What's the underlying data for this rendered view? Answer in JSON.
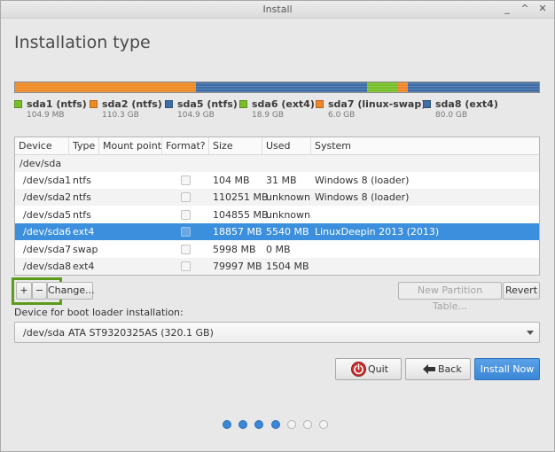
{
  "window": {
    "title": "Install"
  },
  "page": {
    "title": "Installation type"
  },
  "colors": {
    "ntfs_orange": "#ef8b27",
    "blue": "#3f6ea7",
    "green": "#78c02a",
    "swap_orange": "#f0862a",
    "selection": "#3c8fdc"
  },
  "partition_bar": [
    {
      "color": "#3f6ea7",
      "share": 0.0008
    },
    {
      "color": "#ef8b27",
      "share": 0.345
    },
    {
      "color": "#3f6ea7",
      "share": 0.327
    },
    {
      "color": "#78c02a",
      "share": 0.059
    },
    {
      "color": "#f0862a",
      "share": 0.019
    },
    {
      "color": "#3f6ea7",
      "share": 0.25
    }
  ],
  "legend": [
    {
      "name": "sda1 (ntfs)",
      "size": "104.9 MB",
      "color": "#78c02a"
    },
    {
      "name": "sda2 (ntfs)",
      "size": "110.3 GB",
      "color": "#ef8b27"
    },
    {
      "name": "sda5 (ntfs)",
      "size": "104.9 GB",
      "color": "#3f6ea7"
    },
    {
      "name": "sda6 (ext4)",
      "size": "18.9 GB",
      "color": "#78c02a"
    },
    {
      "name": "sda7 (linux-swap)",
      "size": "6.0 GB",
      "color": "#f0862a"
    },
    {
      "name": "sda8 (ext4)",
      "size": "80.0 GB",
      "color": "#3f6ea7"
    }
  ],
  "table": {
    "headers": [
      "Device",
      "Type",
      "Mount point",
      "Format?",
      "Size",
      "Used",
      "System"
    ],
    "group": "/dev/sda",
    "rows": [
      {
        "device": "/dev/sda1",
        "type": "ntfs",
        "mount": "",
        "size": "104 MB",
        "used": "31 MB",
        "system": "Windows 8 (loader)"
      },
      {
        "device": "/dev/sda2",
        "type": "ntfs",
        "mount": "",
        "size": "110251 MB",
        "used": "unknown",
        "system": "Windows 8 (loader)"
      },
      {
        "device": "/dev/sda5",
        "type": "ntfs",
        "mount": "",
        "size": "104855 MB",
        "used": "unknown",
        "system": ""
      },
      {
        "device": "/dev/sda6",
        "type": "ext4",
        "mount": "",
        "size": "18857 MB",
        "used": "5540 MB",
        "system": "LinuxDeepin 2013 (2013)"
      },
      {
        "device": "/dev/sda7",
        "type": "swap",
        "mount": "",
        "size": "5998 MB",
        "used": "0 MB",
        "system": ""
      },
      {
        "device": "/dev/sda8",
        "type": "ext4",
        "mount": "",
        "size": "79997 MB",
        "used": "1504 MB",
        "system": ""
      }
    ],
    "selected_index": 3
  },
  "toolbar": {
    "add": "+",
    "remove": "−",
    "change": "Change...",
    "new_table": "New Partition Table...",
    "revert": "Revert"
  },
  "boot": {
    "label": "Device for boot loader installation:",
    "device": "/dev/sda",
    "description": "ATA ST9320325AS (320.1 GB)"
  },
  "actions": {
    "quit": "Quit",
    "back": "Back",
    "install": "Install Now"
  },
  "progress": {
    "total_steps": 7,
    "completed_steps": 4
  }
}
